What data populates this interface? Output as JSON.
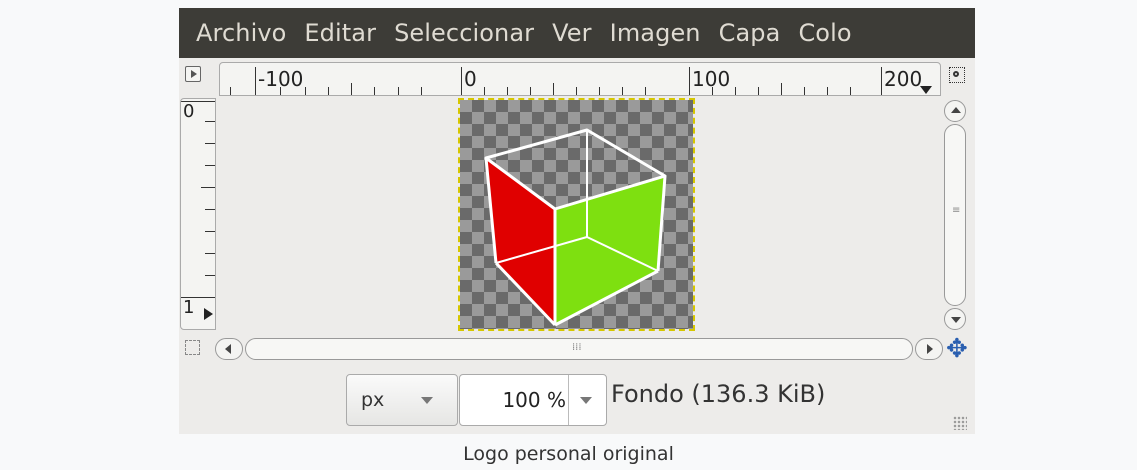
{
  "menubar": {
    "items": [
      "Archivo",
      "Editar",
      "Seleccionar",
      "Ver",
      "Imagen",
      "Capa",
      "Colo"
    ]
  },
  "ruler": {
    "horizontal_labels": [
      "-100",
      "0",
      "100",
      "200"
    ],
    "vertical_labels": [
      "0",
      "1"
    ]
  },
  "image": {
    "colors": {
      "red_face": "#e00000",
      "green_face": "#7ee010",
      "edges": "#ffffff",
      "selection_border": "#d6c700"
    }
  },
  "statusbar": {
    "unit": "px",
    "zoom": "100 %",
    "layer_info": "Fondo (136.3 KiB)"
  },
  "caption": "Logo personal original",
  "colors": {
    "menubar_bg": "#3d3c37",
    "window_bg": "#edecea",
    "nav_icon": "#2a5fb0"
  }
}
